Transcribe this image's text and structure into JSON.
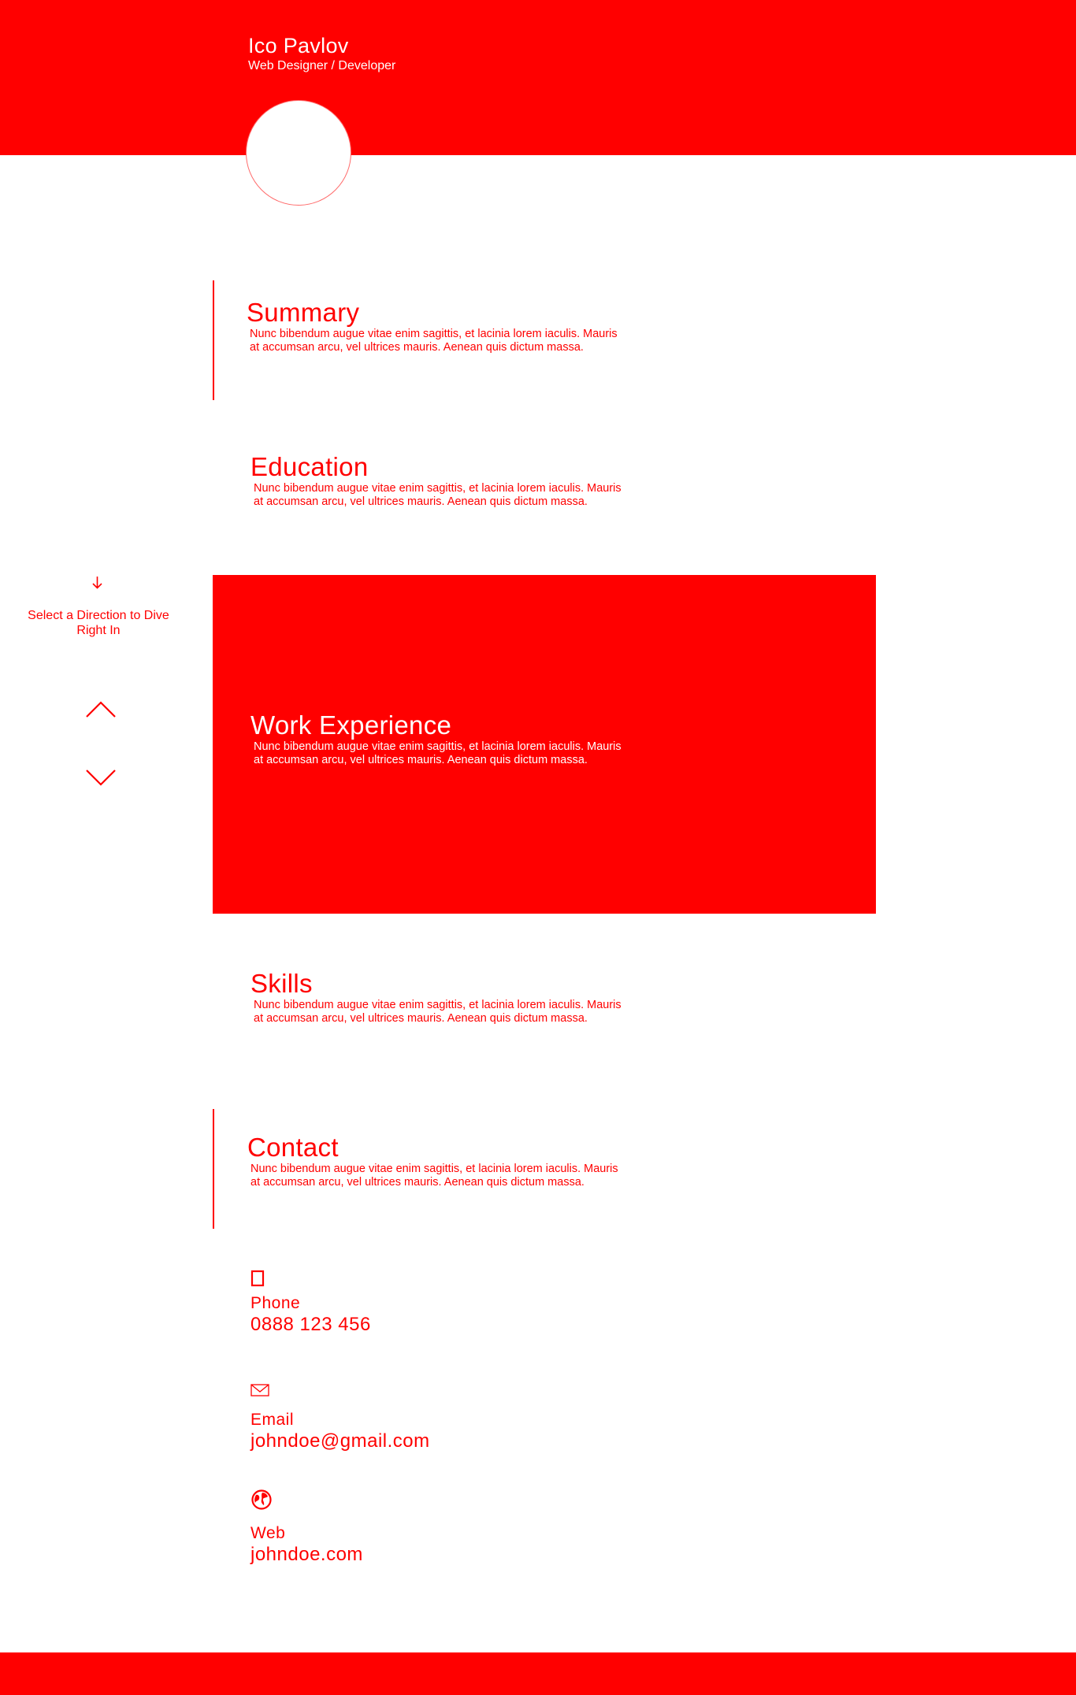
{
  "header": {
    "name": "Ico Pavlov",
    "role": "Web Designer / Developer"
  },
  "sections": {
    "summary": {
      "title": "Summary",
      "text": "Nunc bibendum augue vitae enim sagittis, et lacinia lorem iaculis. Mauris at accumsan arcu, vel ultrices mauris. Aenean quis dictum massa."
    },
    "education": {
      "title": "Education",
      "text": "Nunc bibendum augue vitae enim sagittis, et lacinia lorem iaculis. Mauris at accumsan arcu, vel ultrices mauris. Aenean quis dictum massa."
    },
    "work": {
      "title": "Work Experience",
      "text": "Nunc bibendum augue vitae enim sagittis, et lacinia lorem iaculis. Mauris at accumsan arcu, vel ultrices mauris. Aenean quis dictum massa."
    },
    "skills": {
      "title": "Skills",
      "text": "Nunc bibendum augue vitae enim sagittis, et lacinia lorem iaculis. Mauris at accumsan arcu, vel ultrices mauris. Aenean quis dictum massa."
    },
    "contact": {
      "title": "Contact",
      "text": "Nunc bibendum augue vitae enim sagittis, et lacinia lorem iaculis. Mauris at accumsan arcu, vel ultrices mauris. Aenean quis dictum massa."
    }
  },
  "side_nav": {
    "hint": "Select a Direction to Dive Right In",
    "hint_icon": "arrow-down-icon",
    "up_icon": "chevron-up-icon",
    "down_icon": "chevron-down-icon"
  },
  "contact_items": {
    "phone": {
      "icon": "phone-icon",
      "label": "Phone",
      "value": "0888 123 456"
    },
    "email": {
      "icon": "mail-icon",
      "label": "Email",
      "value": "johndoe@gmail.com"
    },
    "web": {
      "icon": "globe-icon",
      "label": "Web",
      "value": "johndoe.com"
    }
  },
  "colors": {
    "accent": "#ff0000",
    "background": "#ffffff"
  }
}
